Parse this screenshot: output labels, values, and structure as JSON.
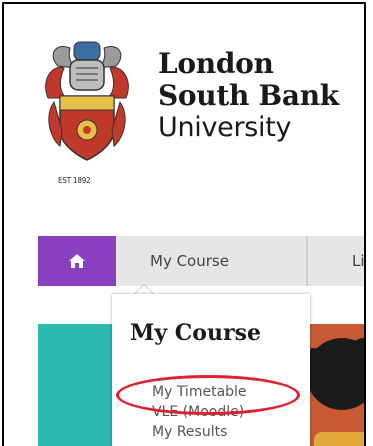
{
  "logo": {
    "line1": "London",
    "line2": "South Bank",
    "line3": "University",
    "established": "EST 1892"
  },
  "nav": {
    "home_icon": "home-icon",
    "items": [
      {
        "label": "My Course"
      },
      {
        "label": "Library"
      }
    ]
  },
  "dropdown": {
    "title": "My Course",
    "items": [
      {
        "label": "My Timetable"
      },
      {
        "label": "VLE (Moodle)"
      },
      {
        "label": "My Results"
      }
    ]
  },
  "colors": {
    "nav_home_bg": "#8a3fc1",
    "nav_bg": "#e6e6e6",
    "hero_teal": "#2bbab0",
    "highlight_circle": "#e0202e"
  }
}
